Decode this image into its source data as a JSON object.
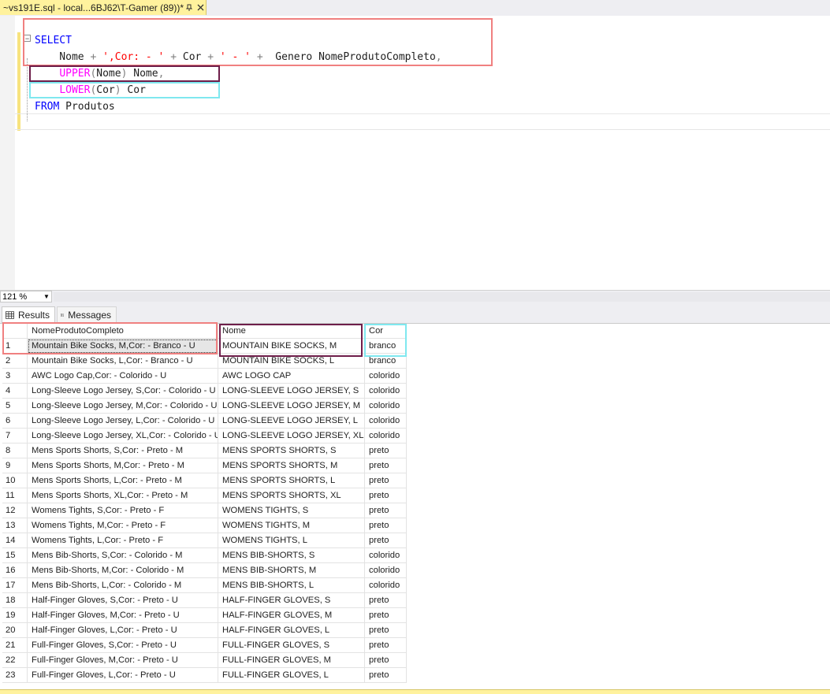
{
  "tab": {
    "title": "~vs191E.sql - local...6BJ62\\T-Gamer (89))*",
    "pin_icon": "pin-icon",
    "close_icon": "close-icon"
  },
  "editor": {
    "collapse_symbol": "−",
    "lines": [
      {
        "parts": [
          {
            "t": "SELECT",
            "c": "kw"
          }
        ]
      },
      {
        "parts": [
          {
            "t": "    Nome "
          },
          {
            "t": "+",
            "c": "op"
          },
          {
            "t": " "
          },
          {
            "t": "',Cor: - '",
            "c": "str"
          },
          {
            "t": " "
          },
          {
            "t": "+",
            "c": "op"
          },
          {
            "t": " Cor "
          },
          {
            "t": "+",
            "c": "op"
          },
          {
            "t": " "
          },
          {
            "t": "' - '",
            "c": "str"
          },
          {
            "t": " "
          },
          {
            "t": "+",
            "c": "op"
          },
          {
            "t": "  Genero NomeProdutoCompleto"
          },
          {
            "t": ",",
            "c": "op"
          }
        ]
      },
      {
        "parts": [
          {
            "t": "    "
          },
          {
            "t": "UPPER",
            "c": "fn"
          },
          {
            "t": "(",
            "c": "op"
          },
          {
            "t": "Nome"
          },
          {
            "t": ")",
            "c": "op"
          },
          {
            "t": " Nome"
          },
          {
            "t": ",",
            "c": "op"
          }
        ]
      },
      {
        "parts": [
          {
            "t": "    "
          },
          {
            "t": "LOWER",
            "c": "fn"
          },
          {
            "t": "(",
            "c": "op"
          },
          {
            "t": "Cor"
          },
          {
            "t": ")",
            "c": "op"
          },
          {
            "t": " Cor"
          }
        ]
      },
      {
        "parts": [
          {
            "t": "FROM",
            "c": "kw"
          },
          {
            "t": " Produtos"
          }
        ]
      }
    ]
  },
  "zoom": {
    "value": "121 %"
  },
  "results_tabs": {
    "results": "Results",
    "messages": "Messages"
  },
  "grid": {
    "columns": [
      "NomeProdutoCompleto",
      "Nome",
      "Cor"
    ],
    "rows": [
      [
        "1",
        "Mountain Bike Socks, M,Cor: - Branco - U",
        "MOUNTAIN BIKE SOCKS, M",
        "branco"
      ],
      [
        "2",
        "Mountain Bike Socks, L,Cor: - Branco - U",
        "MOUNTAIN BIKE SOCKS, L",
        "branco"
      ],
      [
        "3",
        "AWC Logo Cap,Cor: - Colorido - U",
        "AWC LOGO CAP",
        "colorido"
      ],
      [
        "4",
        "Long-Sleeve Logo Jersey, S,Cor: - Colorido - U",
        "LONG-SLEEVE LOGO JERSEY, S",
        "colorido"
      ],
      [
        "5",
        "Long-Sleeve Logo Jersey, M,Cor: - Colorido - U",
        "LONG-SLEEVE LOGO JERSEY, M",
        "colorido"
      ],
      [
        "6",
        "Long-Sleeve Logo Jersey, L,Cor: - Colorido - U",
        "LONG-SLEEVE LOGO JERSEY, L",
        "colorido"
      ],
      [
        "7",
        "Long-Sleeve Logo Jersey, XL,Cor: - Colorido - U",
        "LONG-SLEEVE LOGO JERSEY, XL",
        "colorido"
      ],
      [
        "8",
        "Mens Sports Shorts, S,Cor: - Preto - M",
        "MENS SPORTS SHORTS, S",
        "preto"
      ],
      [
        "9",
        "Mens Sports Shorts, M,Cor: - Preto - M",
        "MENS SPORTS SHORTS, M",
        "preto"
      ],
      [
        "10",
        "Mens Sports Shorts, L,Cor: - Preto - M",
        "MENS SPORTS SHORTS, L",
        "preto"
      ],
      [
        "11",
        "Mens Sports Shorts, XL,Cor: - Preto - M",
        "MENS SPORTS SHORTS, XL",
        "preto"
      ],
      [
        "12",
        "Womens Tights, S,Cor: - Preto - F",
        "WOMENS TIGHTS, S",
        "preto"
      ],
      [
        "13",
        "Womens Tights, M,Cor: - Preto - F",
        "WOMENS TIGHTS, M",
        "preto"
      ],
      [
        "14",
        "Womens Tights, L,Cor: - Preto - F",
        "WOMENS TIGHTS, L",
        "preto"
      ],
      [
        "15",
        "Mens Bib-Shorts, S,Cor: - Colorido - M",
        "MENS BIB-SHORTS, S",
        "colorido"
      ],
      [
        "16",
        "Mens Bib-Shorts, M,Cor: - Colorido - M",
        "MENS BIB-SHORTS, M",
        "colorido"
      ],
      [
        "17",
        "Mens Bib-Shorts, L,Cor: - Colorido - M",
        "MENS BIB-SHORTS, L",
        "colorido"
      ],
      [
        "18",
        "Half-Finger Gloves, S,Cor: - Preto - U",
        "HALF-FINGER GLOVES, S",
        "preto"
      ],
      [
        "19",
        "Half-Finger Gloves, M,Cor: - Preto - U",
        "HALF-FINGER GLOVES, M",
        "preto"
      ],
      [
        "20",
        "Half-Finger Gloves, L,Cor: - Preto - U",
        "HALF-FINGER GLOVES, L",
        "preto"
      ],
      [
        "21",
        "Full-Finger Gloves, S,Cor: - Preto - U",
        "FULL-FINGER GLOVES, S",
        "preto"
      ],
      [
        "22",
        "Full-Finger Gloves, M,Cor: - Preto - U",
        "FULL-FINGER GLOVES, M",
        "preto"
      ],
      [
        "23",
        "Full-Finger Gloves, L,Cor: - Preto - U",
        "FULL-FINGER GLOVES, L",
        "preto"
      ]
    ]
  },
  "colors": {
    "highlight_red": "#f08080",
    "highlight_purple": "#6e1e4a",
    "highlight_cyan": "#7fe8ef",
    "tab_yellow": "#fff29d",
    "keyword": "#0000ff",
    "string": "#ff0000",
    "function": "#ff00ff",
    "operator": "#808080"
  }
}
